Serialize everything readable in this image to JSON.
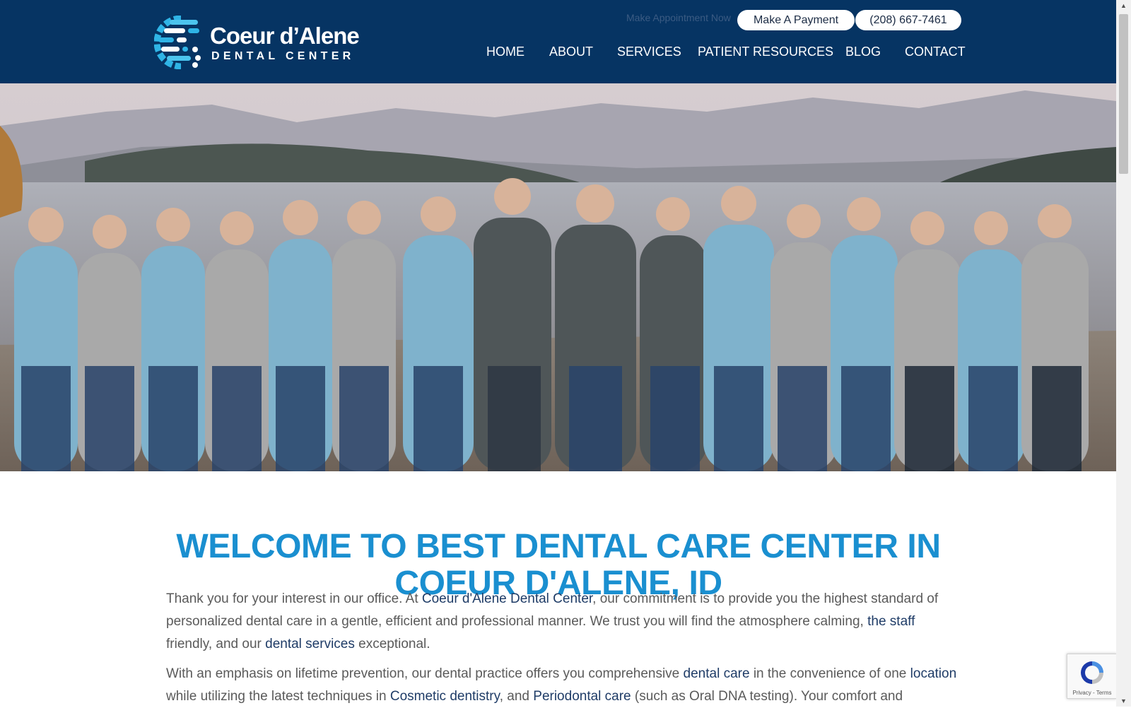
{
  "header": {
    "logo": {
      "line1": "Coeur d’Alene",
      "line2": "DENTAL CENTER"
    },
    "appointment_text": "Make Appointment Now",
    "payment_button": "Make A Payment",
    "phone_button": "(208) 667-7461",
    "nav": [
      {
        "label": "HOME"
      },
      {
        "label": "ABOUT"
      },
      {
        "label": "SERVICES"
      },
      {
        "label": "PATIENT RESOURCES"
      },
      {
        "label": "BLOG"
      },
      {
        "label": "CONTACT"
      }
    ]
  },
  "main": {
    "heading_line1": "WELCOME TO BEST DENTAL CARE CENTER IN",
    "heading_line2": "COEUR D'ALENE, ID",
    "p1": {
      "t1": "Thank you for your interest in our office. At ",
      "link1": "Coeur d'Alene Dental Center",
      "t2": ", our commitment is to provide you the highest standard of personalized dental care in a gentle, efficient and professional manner. We trust you will find the atmosphere calming, ",
      "link2": "the staff",
      "t3": " friendly, and our ",
      "link3": "dental services",
      "t4": " exceptional."
    },
    "p2": {
      "t1": "With an emphasis on lifetime prevention, our dental practice offers you comprehensive ",
      "link1": "dental care",
      "t2": " in the convenience of one ",
      "link2": "location",
      "t3": " while utilizing the latest techniques in ",
      "link3": "Cosmetic dentistry",
      "t4": ", and ",
      "link4": "Periodontal care",
      "t5": " (such as Oral DNA testing). Your comfort and"
    }
  },
  "recaptcha": {
    "privacy": "Privacy",
    "terms": "Terms"
  },
  "colors": {
    "header_bg": "#063463",
    "heading": "#1a8fd0",
    "link": "#1f3c67",
    "body_text": "#5a5a5a",
    "logo_accent": "#2fb4e6"
  }
}
